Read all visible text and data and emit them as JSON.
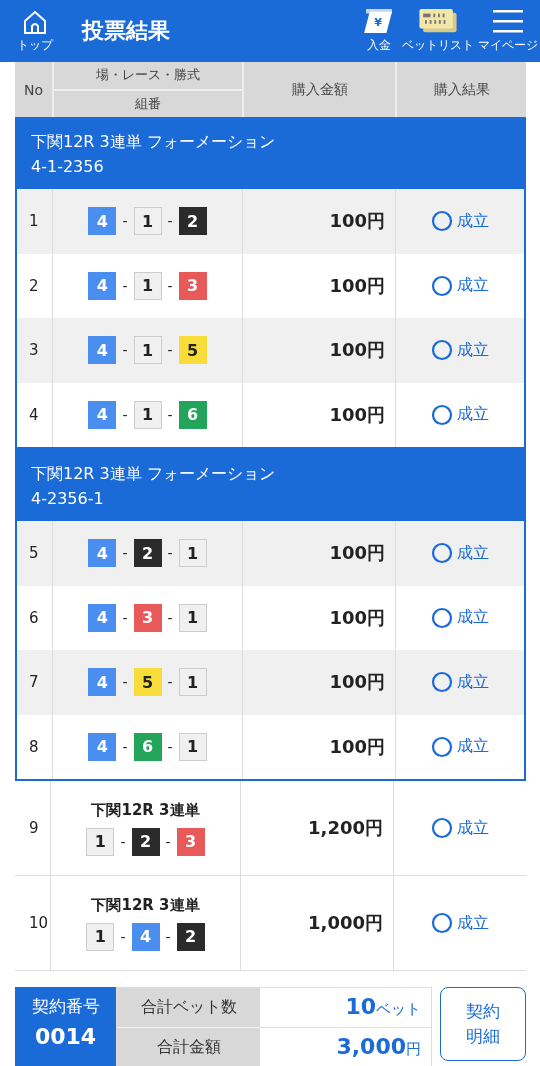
{
  "header": {
    "home_label": "トップ",
    "title": "投票結果",
    "actions": [
      {
        "kind": "deposit",
        "glyph": "¥",
        "label": "入金"
      },
      {
        "kind": "betlist",
        "label": "ベットリスト"
      },
      {
        "kind": "menu",
        "label": "マイページ"
      }
    ]
  },
  "table": {
    "columns": [
      "No",
      "場・レース・勝式",
      "組番",
      "購入金額",
      "購入結果"
    ],
    "sections": [
      {
        "kind": "group",
        "title": "下関12R 3連単 フォーメーション",
        "code": "4-1-2356",
        "rows": [
          {
            "no": "1",
            "picks": [
              {
                "num": "4",
                "color": "#4a8ef0"
              },
              {
                "sep": "-",
                "num": "1",
                "color": "#f0f0f0"
              },
              {
                "sep": "-",
                "num": "2",
                "color": "#2b2b2b"
              }
            ],
            "amount": "100円",
            "result": "成立"
          },
          {
            "no": "2",
            "picks": [
              {
                "num": "4",
                "color": "#4a8ef0"
              },
              {
                "sep": "-",
                "num": "1",
                "color": "#f0f0f0"
              },
              {
                "sep": "-",
                "num": "3",
                "color": "#e85a5a"
              }
            ],
            "amount": "100円",
            "result": "成立"
          },
          {
            "no": "3",
            "picks": [
              {
                "num": "4",
                "color": "#4a8ef0"
              },
              {
                "sep": "-",
                "num": "1",
                "color": "#f0f0f0"
              },
              {
                "sep": "-",
                "num": "5",
                "color": "#f8dc3a"
              }
            ],
            "amount": "100円",
            "result": "成立"
          },
          {
            "no": "4",
            "picks": [
              {
                "num": "4",
                "color": "#4a8ef0"
              },
              {
                "sep": "-",
                "num": "1",
                "color": "#f0f0f0"
              },
              {
                "sep": "-",
                "num": "6",
                "color": "#22a55a"
              }
            ],
            "amount": "100円",
            "result": "成立"
          }
        ]
      },
      {
        "kind": "group",
        "title": "下関12R 3連単 フォーメーション",
        "code": "4-2356-1",
        "rows": [
          {
            "no": "5",
            "picks": [
              {
                "num": "4",
                "color": "#4a8ef0"
              },
              {
                "sep": "-",
                "num": "2",
                "color": "#2b2b2b"
              },
              {
                "sep": "-",
                "num": "1",
                "color": "#f0f0f0"
              }
            ],
            "amount": "100円",
            "result": "成立"
          },
          {
            "no": "6",
            "picks": [
              {
                "num": "4",
                "color": "#4a8ef0"
              },
              {
                "sep": "-",
                "num": "3",
                "color": "#e85a5a"
              },
              {
                "sep": "-",
                "num": "1",
                "color": "#f0f0f0"
              }
            ],
            "amount": "100円",
            "result": "成立"
          },
          {
            "no": "7",
            "picks": [
              {
                "num": "4",
                "color": "#4a8ef0"
              },
              {
                "sep": "-",
                "num": "5",
                "color": "#f8dc3a"
              },
              {
                "sep": "-",
                "num": "1",
                "color": "#f0f0f0"
              }
            ],
            "amount": "100円",
            "result": "成立"
          },
          {
            "no": "8",
            "picks": [
              {
                "num": "4",
                "color": "#4a8ef0"
              },
              {
                "sep": "-",
                "num": "6",
                "color": "#22a55a"
              },
              {
                "sep": "-",
                "num": "1",
                "color": "#f0f0f0"
              }
            ],
            "amount": "100円",
            "result": "成立"
          }
        ]
      },
      {
        "kind": "single",
        "rows": [
          {
            "no": "9",
            "race": "下関12R 3連単",
            "picks": [
              {
                "num": "1",
                "color": "#f0f0f0"
              },
              {
                "sep": "-",
                "num": "2",
                "color": "#2b2b2b"
              },
              {
                "sep": "-",
                "num": "3",
                "color": "#e85a5a"
              }
            ],
            "amount": "1,200円",
            "result": "成立"
          },
          {
            "no": "10",
            "race": "下関12R 3連単",
            "picks": [
              {
                "num": "1",
                "color": "#f0f0f0"
              },
              {
                "sep": "-",
                "num": "4",
                "color": "#4a8ef0"
              },
              {
                "sep": "-",
                "num": "2",
                "color": "#2b2b2b"
              }
            ],
            "amount": "1,000円",
            "result": "成立"
          }
        ]
      }
    ]
  },
  "summary": {
    "contract_label": "契約番号",
    "contract_no": "0014",
    "totals": [
      {
        "label": "合計ベット数",
        "value": "10",
        "unit": "ベット"
      },
      {
        "label": "合計金額",
        "value": "3,000",
        "unit": "円"
      }
    ],
    "detail_button": "契約明細"
  }
}
